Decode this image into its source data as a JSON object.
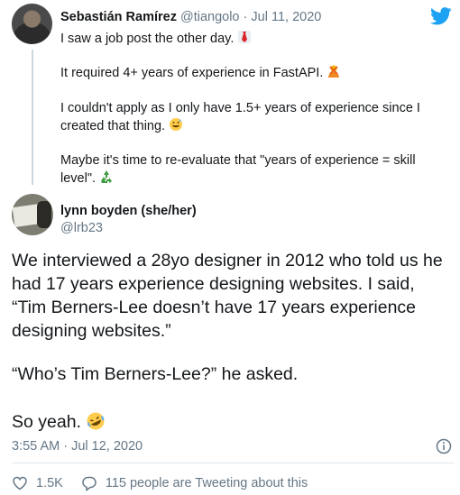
{
  "colors": {
    "twitter_blue": "#1da1f2",
    "secondary_text": "#657786",
    "primary_text": "#14171a"
  },
  "tweet": {
    "author_name": "Sebastián Ramírez",
    "author_handle": "@tiangolo",
    "separator": "·",
    "date": "Jul 11, 2020",
    "paragraphs": [
      "I saw a job post the other day.",
      "It required 4+ years of experience in FastAPI.",
      "I couldn't apply as I only have 1.5+ years of experience since I created that thing.",
      "Maybe it's time to re-evaluate that \"years of experience = skill level\"."
    ],
    "emojis": [
      "necktie",
      "person-gesturing-no",
      "grinning-sweat",
      "recycling-symbol"
    ]
  },
  "reply": {
    "author_name": "lynn boyden (she/her)",
    "author_handle": "@lrb23",
    "paragraphs": [
      "We interviewed a 28yo designer in 2012 who told us he had 17 years experience designing websites. I said, “Tim Berners-Lee doesn’t have 17 years experience designing websites.”",
      "“Who’s Tim Berners-Lee?” he asked.",
      "So yeah."
    ],
    "emoji": "rolling-on-floor-laughing",
    "timestamp": "3:55 AM · Jul 12, 2020",
    "likes": "1.5K",
    "tweeting_about": "115 people are Tweeting about this"
  },
  "icons": [
    "twitter-bird-icon",
    "info-icon",
    "heart-icon",
    "comment-icon"
  ]
}
